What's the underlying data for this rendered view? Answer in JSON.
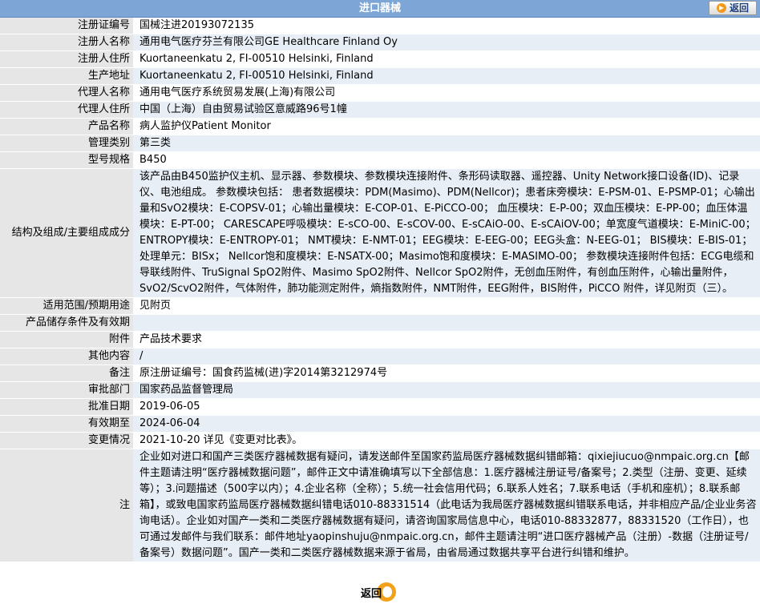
{
  "header": {
    "title": "进口器械",
    "back_label": "返回"
  },
  "rows": [
    {
      "label": "注册证编号",
      "value": "国械注进20193072135"
    },
    {
      "label": "注册人名称",
      "value": "通用电气医疗芬兰有限公司GE Healthcare Finland Oy"
    },
    {
      "label": "注册人住所",
      "value": "Kuortaneenkatu 2, FI-00510 Helsinki, Finland"
    },
    {
      "label": "生产地址",
      "value": "Kuortaneenkatu 2, FI-00510 Helsinki, Finland"
    },
    {
      "label": "代理人名称",
      "value": "通用电气医疗系统贸易发展(上海)有限公司"
    },
    {
      "label": "代理人住所",
      "value": "中国（上海）自由贸易试验区意威路96号1幢"
    },
    {
      "label": "产品名称",
      "value": "病人监护仪Patient Monitor"
    },
    {
      "label": "管理类别",
      "value": "第三类"
    },
    {
      "label": "型号规格",
      "value": "B450"
    },
    {
      "label": "结构及组成/主要组成成分",
      "value": "该产品由B450监护仪主机、显示器、参数模块、参数模块连接附件、条形码读取器、遥控器、Unity Network接口设备(ID)、记录仪、电池组成。 参数模块包括： 患者数据模块：PDM(Masimo)、PDM(Nellcor)；患者床旁模块：E-PSM-01、E-PSMP-01；心输出量和SvO2模块：E-COPSV-01；心输出量模块：E-COP-01、E-PiCCO-00； 血压模块：E-P-00；双血压模块：E-PP-00；血压体温模块：E-PT-00； CARESCAPE呼吸模块：E-sCO-00、E-sCOV-00、E-sCAiO-00、E-sCAiOV-00；单宽度气道模块：E-MiniC-00；ENTROPY模块：E-ENTROPY-01； NMT模块：E-NMT-01；EEG模块：E-EEG-00；EEG头盒：N-EEG-01； BIS模块：E-BIS-01；处理单元：BISx； Nellcor饱和度模块：E-NSATX-00；Masimo饱和度模块：E-MASIMO-00； 参数模块连接附件包括：ECG电缆和导联线附件、TruSignal SpO2附件、Masimo SpO2附件、Nellcor SpO2附件，无创血压附件，有创血压附件，心输出量附件，SvO2/ScvO2附件，气体附件，肺功能测定附件，熵指数附件，NMT附件，EEG附件，BIS附件，PiCCO 附件，详见附页（三）。"
    },
    {
      "label": "适用范围/预期用途",
      "value": "见附页"
    },
    {
      "label": "产品储存条件及有效期",
      "value": ""
    },
    {
      "label": "附件",
      "value": "产品技术要求"
    },
    {
      "label": "其他内容",
      "value": "/"
    },
    {
      "label": "备注",
      "value": "原注册证编号：国食药监械(进)字2014第3212974号"
    },
    {
      "label": "审批部门",
      "value": "国家药品监督管理局"
    },
    {
      "label": "批准日期",
      "value": "2019-06-05"
    },
    {
      "label": "有效期至",
      "value": "2024-06-04"
    },
    {
      "label": "变更情况",
      "value": "2021-10-20 详见《变更对比表》。"
    },
    {
      "label": "注",
      "value": "企业如对进口和国产三类医疗器械数据有疑问，请发送邮件至国家药监局医疗器械数据纠错邮箱：qixiejiucuo@nmpaic.org.cn【邮件主题请注明“医疗器械数据问题”，邮件正文中请准确填写以下全部信息：1.医疗器械注册证号/备案号；2.类型（注册、变更、延续等）；3.问题描述（500字以内）；4.企业名称（全称）；5.统一社会信用代码；6.联系人姓名；7.联系电话（手机和座机）；8.联系邮箱】，或致电国家药监局医疗器械数据纠错电话010-88331514（此电话为我局医疗器械数据纠错联系电话，并非相应产品/企业业务咨询电话）。企业如对国产一类和二类医疗器械数据有疑问，请咨询国家局信息中心，电话010-88332877，88331520（工作日），也可通过发邮件与我们联系：邮件地址yaopinshuju@nmpaic.org.cn，邮件主题请注明“进口医疗器械产品（注册）-数据（注册证号/备案号）数据问题”。国产一类和二类医疗器械数据来源于省局，由省局通过数据共享平台进行纠错和维护。"
    }
  ],
  "footer": {
    "back_label": "返回"
  }
}
